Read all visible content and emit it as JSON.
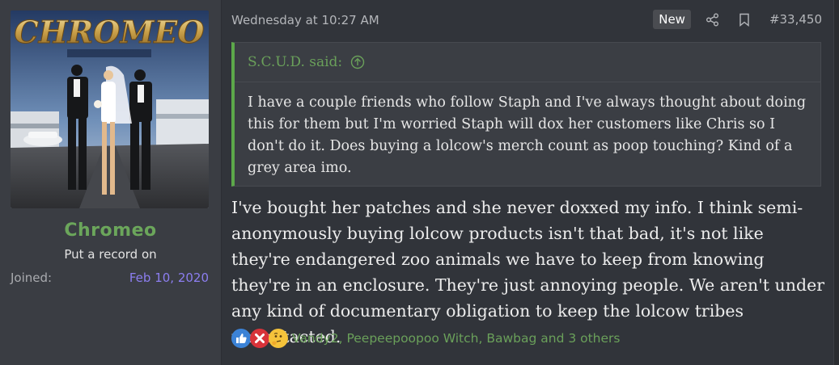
{
  "user": {
    "avatar_alt": "Chromeo album cover avatar",
    "name": "Chromeo",
    "title": "Put a record on",
    "joined_label": "Joined:",
    "joined_date": "Feb 10, 2020"
  },
  "post": {
    "date": "Wednesday at 10:27 AM",
    "new_badge": "New",
    "number": "#33,450",
    "quote": {
      "author": "S.C.U.D. said:",
      "text": "I have a couple friends who follow Staph and I've always thought about doing this for them but I'm worried Staph will dox her customers like Chris so I don't do it. Does buying a lolcow's merch count as poop touching? Kind of a grey area imo."
    },
    "message": "I've bought her patches and she never doxxed my info. I think semi-anonymously buying lolcow products isn't that bad, it's not like they're endangered zoo animals we have to keep from knowing they're in an enclosure. They're just annoying people. We aren't under any kind of documentary obligation to keep the lolcow tribes uncontacted.",
    "reactions": {
      "icons": [
        "like-icon",
        "dumb-icon",
        "thinking-icon"
      ],
      "text": "Vandy2, Peepeepoopoo Witch, Bawbag and 3 others"
    }
  },
  "colors": {
    "username": "#6ba65b",
    "joined_date": "#8c7ef0",
    "quote_bar": "#5ca84a",
    "panel": "#3a3d43",
    "post_bg": "#31343a"
  }
}
